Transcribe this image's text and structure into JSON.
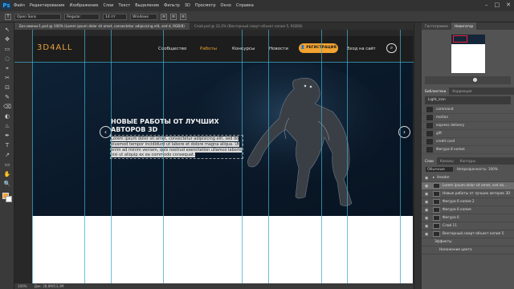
{
  "app": {
    "logo": "Ps",
    "menu": [
      "Файл",
      "Редактирование",
      "Изображение",
      "Слои",
      "Текст",
      "Выделение",
      "Фильтр",
      "3D",
      "Просмотр",
      "Окно",
      "Справка"
    ],
    "window_controls": [
      "–",
      "□",
      "✕"
    ]
  },
  "options_bar": {
    "font_family": "Open Sans",
    "font_style": "Regular",
    "font_size": "14 пт",
    "antialias": "Windows"
  },
  "tabs": [
    {
      "label": "Без имени-1.psd @ 100% (Lorem ipsum dolor sit amet, consectetur adipisicing elit, sed d, RGB/8)",
      "active": true
    },
    {
      "label": "Слой.psd @ 33,3% (Векторный смарт-объект копия 5, RGB/8)",
      "active": false
    }
  ],
  "tools": [
    "↖",
    "✥",
    "▭",
    "◌",
    "⌖",
    "✂",
    "⊡",
    "✎",
    "⌫",
    "◐",
    "♨",
    "✒",
    "T",
    "↗",
    "▭",
    "✋",
    "🔍"
  ],
  "site": {
    "logo": "3D4ALL",
    "nav": [
      "Сообщество",
      "Работы",
      "Конкурсы",
      "Новости"
    ],
    "register_button": "РЕГИСТРАЦИЯ",
    "login_link": "Вход на сайт",
    "hero_title": "НОВЫЕ РАБОТЫ ОТ ЛУЧШИХ АВТОРОВ 3D",
    "hero_text": "Lorem ipsum dolor sit amet, consectetur adipisicing elit, sed do eiusmod tempor incididunt ut labore et dolore magna aliqua. Ut enim ad minim veniam, quis nostrud exercitation ullamco laboris nisi ut aliquip ex ea commodo consequat.",
    "arrow_left": "‹",
    "arrow_right": "›"
  },
  "status": {
    "zoom": "100%",
    "doc": "Док: 28,8M/53,3M"
  },
  "panels": {
    "top_tabs": [
      "Гистограмма",
      "Навигатор"
    ],
    "library_tabs": [
      "Библиотеки",
      "Коррекция"
    ],
    "library_name": "Light_icon",
    "library_items": [
      "command",
      "motion",
      "express delivery",
      "gift",
      "credit card",
      "Фигура 8 копия"
    ],
    "layer_tabs": [
      "Слои",
      "Каналы",
      "Контуры"
    ],
    "blend_mode": "Обычные",
    "opacity_label": "Непрозрачность: 100%",
    "layers": [
      {
        "name": "Header",
        "selected": false
      },
      {
        "name": "Lorem ipsum dolor sit amet, sed do...",
        "selected": true
      },
      {
        "name": "Новые работы от лучших авторов 3D",
        "selected": false
      },
      {
        "name": "Фигура 6 копия 2",
        "selected": false
      },
      {
        "name": "Фигура 6 копия",
        "selected": false
      },
      {
        "name": "Фигура 6",
        "selected": false
      },
      {
        "name": "Слой 11",
        "selected": false
      },
      {
        "name": "Векторный смарт-объект копия 5",
        "selected": false
      },
      {
        "name": "Эффекты",
        "selected": false
      },
      {
        "name": "Наложение цвета",
        "selected": false
      }
    ]
  }
}
